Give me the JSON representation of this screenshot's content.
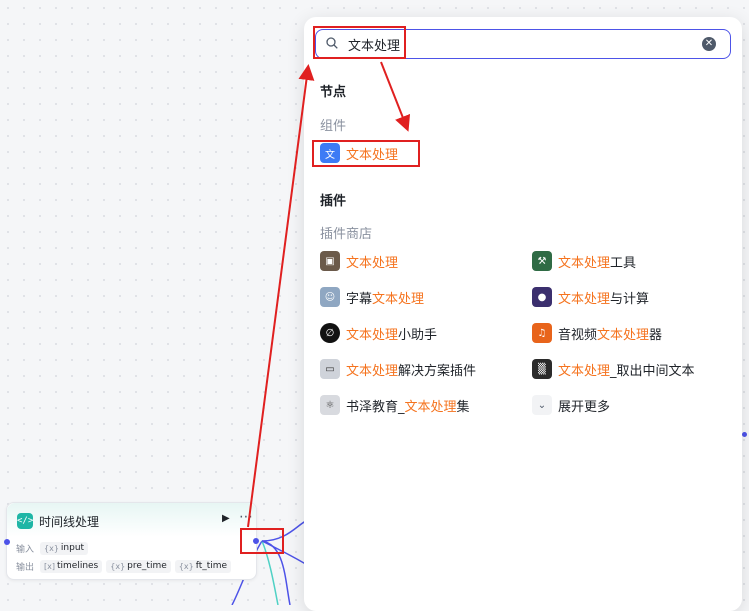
{
  "node_card": {
    "icon": "code-icon",
    "title": "时间线处理",
    "run_icon": "play-icon",
    "more_icon": "more-icon",
    "input_label": "输入",
    "output_label": "输出",
    "inputs": [
      {
        "type": "{x}",
        "name": "input"
      }
    ],
    "outputs": [
      {
        "type": "[x]",
        "name": "timelines"
      },
      {
        "type": "{x}",
        "name": "pre_time"
      },
      {
        "type": "{x}",
        "name": "ft_time"
      }
    ]
  },
  "search": {
    "value": "文本处理",
    "icon": "search-icon",
    "clear_icon": "clear-icon"
  },
  "sections": {
    "nodes": "节点",
    "components": "组件",
    "plugins": "插件",
    "plugin_store": "插件商店"
  },
  "component_item": {
    "icon": "text-process-icon",
    "highlight": "文本处理",
    "rest": ""
  },
  "plugin_items": [
    {
      "icon": "photo-icon",
      "pre": "",
      "highlight": "文本处理",
      "post": ""
    },
    {
      "icon": "tool-icon",
      "pre": "",
      "highlight": "文本处理",
      "post": "工具"
    },
    {
      "icon": "avatar-icon",
      "pre": "字幕",
      "highlight": "文本处理",
      "post": ""
    },
    {
      "icon": "planet-icon",
      "pre": "",
      "highlight": "文本处理",
      "post": "与计算"
    },
    {
      "icon": "empty-set-icon",
      "pre": "",
      "highlight": "文本处理",
      "post": "小助手"
    },
    {
      "icon": "audio-video-icon",
      "pre": "音视频",
      "highlight": "文本处理",
      "post": "器"
    },
    {
      "icon": "monitor-icon",
      "pre": "",
      "highlight": "文本处理",
      "post": "解决方案插件"
    },
    {
      "icon": "noise-icon",
      "pre": "",
      "highlight": "文本处理",
      "post": "_取出中间文本"
    },
    {
      "icon": "atom-icon",
      "pre": "书泽教育_",
      "highlight": "文本处理",
      "post": "集"
    }
  ],
  "expand_more": {
    "icon": "chevron-down-icon",
    "label": "展开更多"
  },
  "colors": {
    "accent": "#4d53e8",
    "highlight": "#f5731e",
    "annotation": "#e02020",
    "node_icon": "#1fb6a6"
  }
}
